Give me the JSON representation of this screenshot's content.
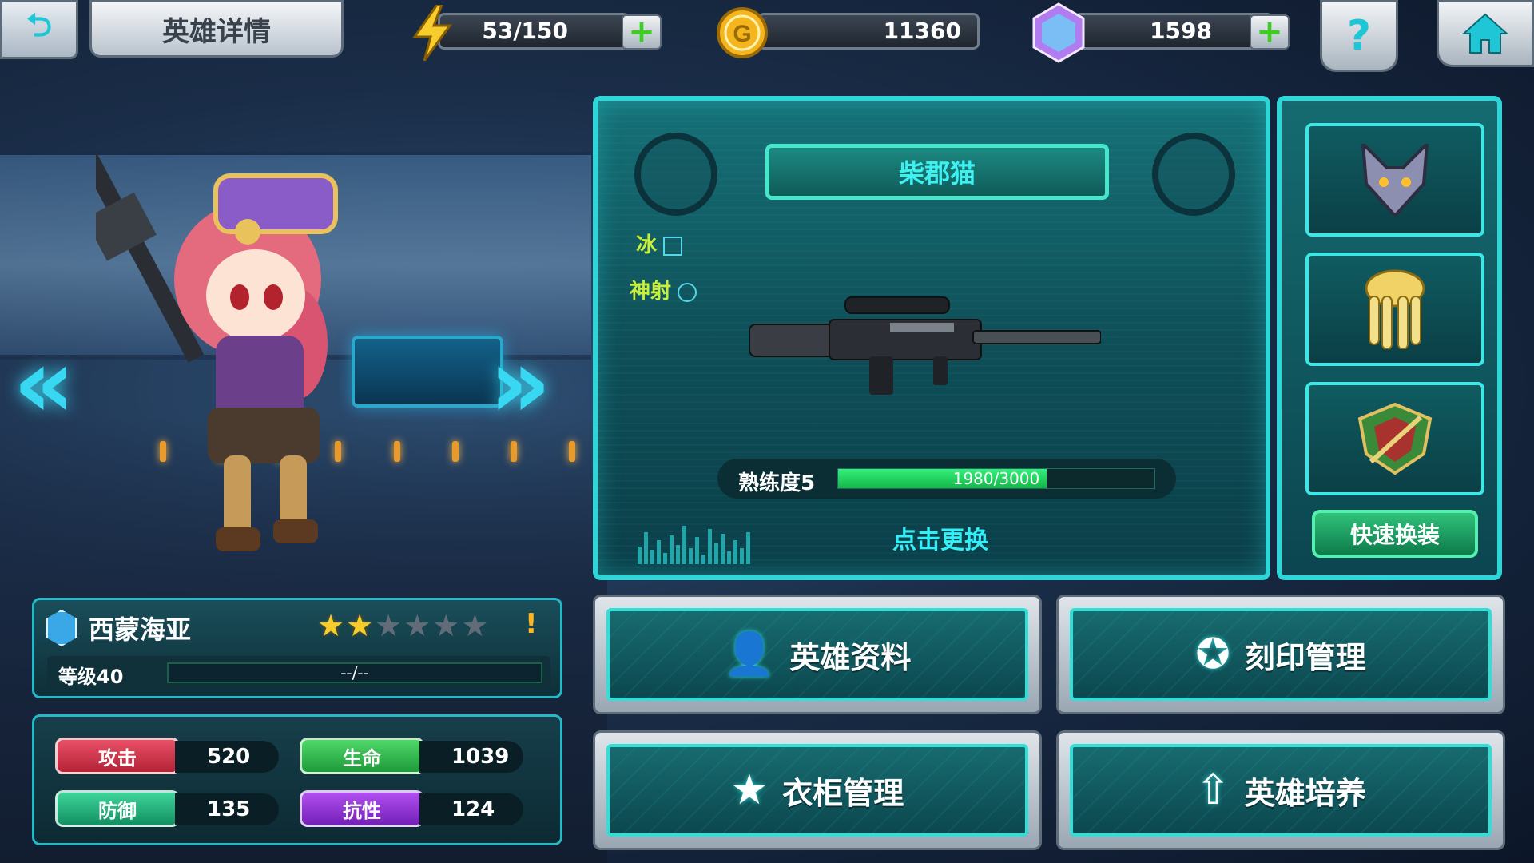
{
  "header": {
    "title": "英雄详情",
    "energy": "53/150",
    "gold": "11360",
    "gems": "1598",
    "back_icon": "back-arrow-icon",
    "help_label": "?",
    "home_icon": "home-icon"
  },
  "hero": {
    "name": "西蒙海亚",
    "stars_filled": 2,
    "stars_total": 6,
    "stars_on": "★★",
    "stars_off": "★★★★",
    "warning": "!",
    "level_label": "等级40",
    "xp_text": "--/--"
  },
  "stats": [
    {
      "label": "攻击",
      "value": "520",
      "color": "#d8364d"
    },
    {
      "label": "生命",
      "value": "1039",
      "color": "#2ebf4f"
    },
    {
      "label": "防御",
      "value": "135",
      "color": "#1fb57c"
    },
    {
      "label": "抗性",
      "value": "124",
      "color": "#9432d6"
    }
  ],
  "weapon": {
    "name": "柴郡猫",
    "attr1": "冰",
    "attr2": "神射",
    "proficiency_label": "熟练度5",
    "proficiency_current": 1980,
    "proficiency_max": 3000,
    "proficiency_text": "1980/3000",
    "change_label": "点击更换"
  },
  "equip": {
    "slots": [
      "wolf-head-helmet-icon",
      "golden-armor-icon",
      "shield-emblem-icon"
    ],
    "quick_label": "快速换装"
  },
  "menu": [
    {
      "label": "英雄资料",
      "icon": "hero-profile-icon"
    },
    {
      "label": "刻印管理",
      "icon": "engraving-icon"
    },
    {
      "label": "衣柜管理",
      "icon": "wardrobe-icon"
    },
    {
      "label": "英雄培养",
      "icon": "hero-upgrade-icon"
    }
  ],
  "colors": {
    "accent": "#2fd6d8",
    "energy": "#f7cd2d",
    "gold": "#e7a21c",
    "gem": "#b07cf0"
  }
}
